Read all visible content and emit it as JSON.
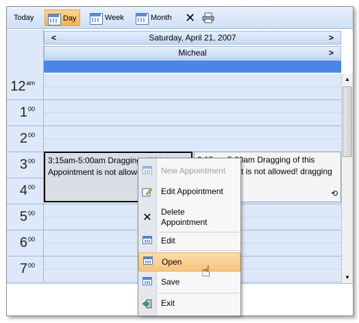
{
  "toolbar": {
    "today_label": "Today",
    "day_label": "Day",
    "week_label": "Week",
    "month_label": "Month",
    "icons": {
      "day": "calendar-day-icon",
      "week": "calendar-week-icon",
      "month": "calendar-month-icon",
      "delete": "close-icon",
      "print": "printer-icon"
    },
    "active_view": "Day"
  },
  "nav": {
    "date_label": "Saturday, April 21, 2007",
    "resource_label": "Micheal",
    "prev_symbol": "<",
    "next_symbol": ">"
  },
  "hours": [
    {
      "hour": "12",
      "suffix": "am"
    },
    {
      "hour": "1",
      "suffix": "00"
    },
    {
      "hour": "2",
      "suffix": "00"
    },
    {
      "hour": "3",
      "suffix": "00"
    },
    {
      "hour": "4",
      "suffix": "00"
    },
    {
      "hour": "5",
      "suffix": "00"
    },
    {
      "hour": "6",
      "suffix": "00"
    },
    {
      "hour": "7",
      "suffix": "00"
    }
  ],
  "appointments": [
    {
      "text": "3:15am-5:00am Dragging of this Appointment is not allowed!"
    },
    {
      "text": "3:15am-5:00am Dragging of this Appointment is not allowed! dragging property set"
    }
  ],
  "context_menu": {
    "items": [
      {
        "label": "New Appointment",
        "icon": "calendar-icon",
        "disabled": true
      },
      {
        "label": "Edit Appointment",
        "icon": "edit-icon",
        "disabled": false
      },
      {
        "label": "Delete\nAppointment",
        "icon": "delete-icon",
        "disabled": false
      },
      {
        "label": "Edit",
        "icon": "calendar-icon",
        "disabled": false
      },
      {
        "label": "Open",
        "icon": "calendar-icon",
        "disabled": false,
        "hover": true
      },
      {
        "label": "Save",
        "icon": "calendar-icon",
        "disabled": false
      },
      {
        "label": "Exit",
        "icon": "exit-icon",
        "disabled": false
      }
    ]
  },
  "colors": {
    "accent_blue": "#4a86e8",
    "grid_bg": "#dde8f8",
    "hover_orange": "#f8c47c"
  }
}
